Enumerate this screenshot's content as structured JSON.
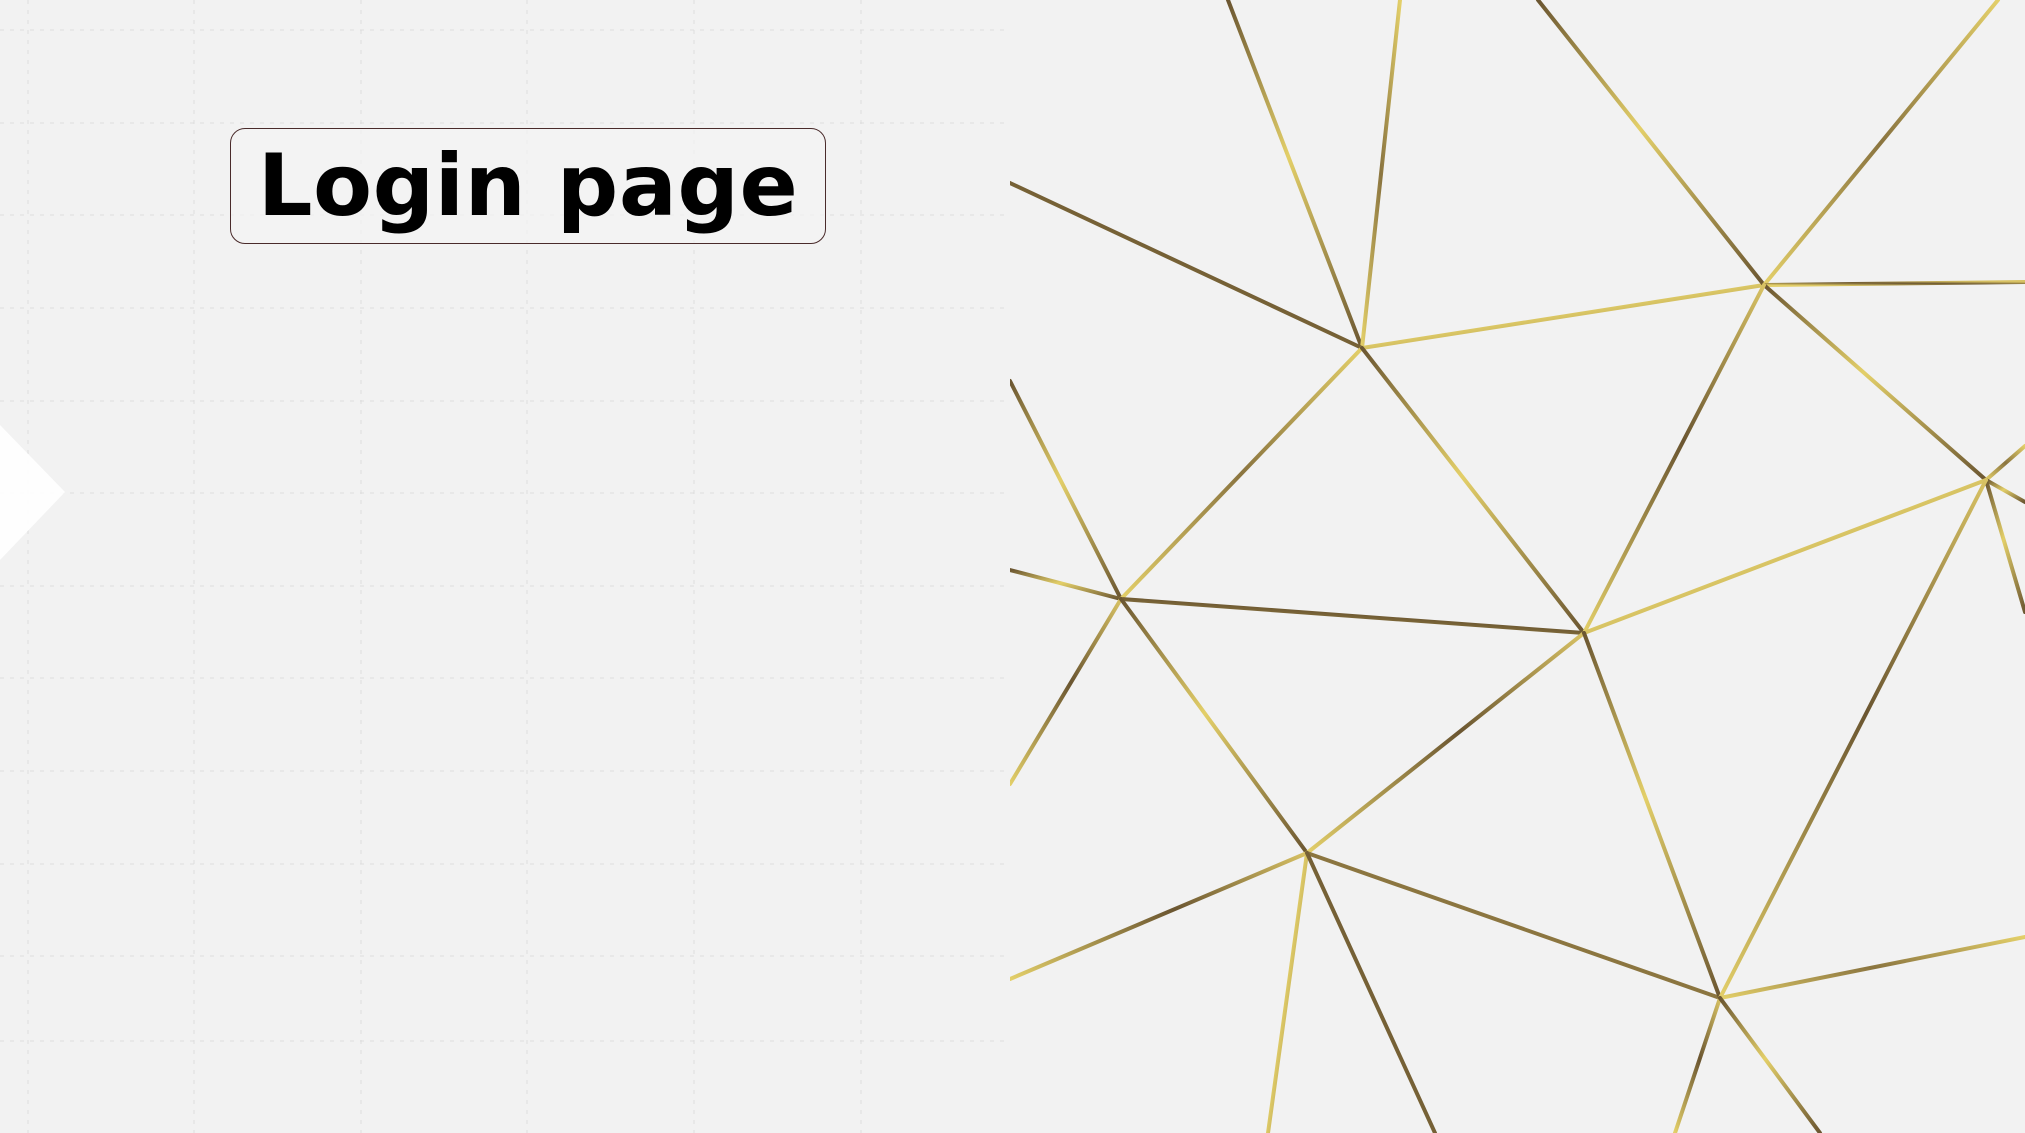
{
  "page": {
    "title": "Login page"
  },
  "colors": {
    "background": "#f2f2f2",
    "grid": "#d6d6d6",
    "title_border": "#4a2b2b",
    "gold_light": "#e3cf69",
    "gold_dark": "#6b5631"
  },
  "icons": {
    "left_arrow": "chevron-right-icon",
    "decorative_pattern": "gold-geometric-lines-icon"
  }
}
